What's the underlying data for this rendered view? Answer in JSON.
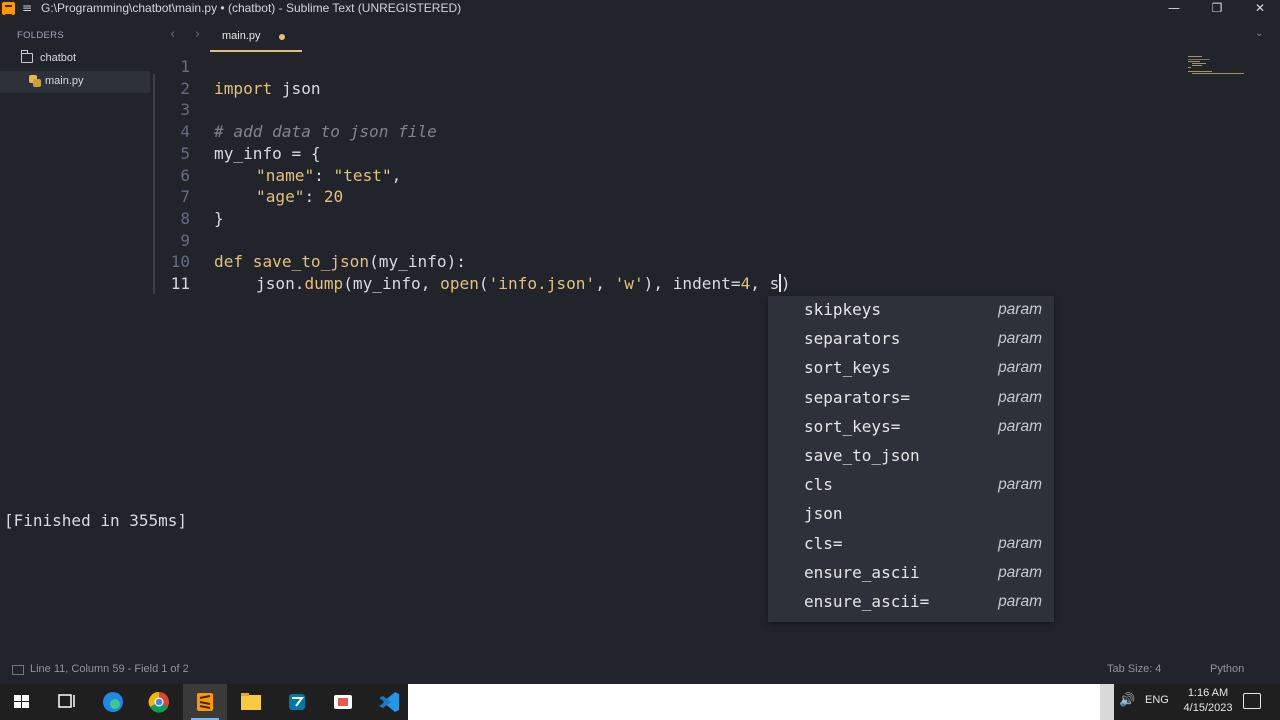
{
  "window": {
    "title": "G:\\Programming\\chatbot\\main.py • (chatbot) - Sublime Text (UNREGISTERED)",
    "menu_glyph": "≡",
    "minimize": "—",
    "restore": "❐",
    "close": "✕"
  },
  "sidebar": {
    "heading": "FOLDERS",
    "folder": "chatbot",
    "file": "main.py"
  },
  "tabs": {
    "back": "‹",
    "forward": "›",
    "active_label": "main.py",
    "dropdown": "⌄"
  },
  "editor": {
    "line_numbers": [
      "1",
      "2",
      "3",
      "4",
      "5",
      "6",
      "7",
      "8",
      "9",
      "10",
      "11"
    ],
    "lines": {
      "l2_kw": "import",
      "l2_rest": " json",
      "l4": "# add data to json file",
      "l5": "my_info = {",
      "l6_key": "\"name\"",
      "l6_sep": ": ",
      "l6_val": "\"test\"",
      "l6_end": ",",
      "l7_key": "\"age\"",
      "l7_sep": ": ",
      "l7_val": "20",
      "l8": "}",
      "l10_kw": "def",
      "l10_fn": "save_to_json",
      "l10_rest": "(my_info):",
      "l11_a": "json.",
      "l11_b": "dump",
      "l11_c": "(my_info, ",
      "l11_d": "open",
      "l11_e": "(",
      "l11_f": "'info.json'",
      "l11_g": ", ",
      "l11_h": "'w'",
      "l11_i": "), indent=",
      "l11_j": "4",
      "l11_k": ", s",
      "l11_l": ")"
    }
  },
  "output": "[Finished in 355ms]",
  "autocomplete": [
    {
      "name": "skipkeys",
      "kind": "param"
    },
    {
      "name": "separators",
      "kind": "param"
    },
    {
      "name": "sort_keys",
      "kind": "param"
    },
    {
      "name": "separators=",
      "kind": "param"
    },
    {
      "name": "sort_keys=",
      "kind": "param"
    },
    {
      "name": "save_to_json",
      "kind": ""
    },
    {
      "name": "cls",
      "kind": "param"
    },
    {
      "name": "json",
      "kind": ""
    },
    {
      "name": "cls=",
      "kind": "param"
    },
    {
      "name": "ensure_ascii",
      "kind": "param"
    },
    {
      "name": "ensure_ascii=",
      "kind": "param"
    }
  ],
  "status": {
    "position": "Line 11, Column 59 - Field 1 of 2",
    "tab_size": "Tab Size: 4",
    "syntax": "Python"
  },
  "taskbar": {
    "language": "ENG",
    "time": "1:16 AM",
    "date": "4/15/2023",
    "speaker": "🔊"
  },
  "colors": {
    "accent": "#e5c07b",
    "background": "#21252b",
    "popup": "#2c313a"
  }
}
